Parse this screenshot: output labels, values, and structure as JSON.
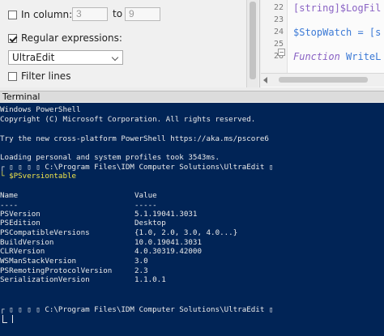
{
  "find_options": {
    "in_column_label": "In column:",
    "column_from": "3",
    "to_label": "to",
    "column_to": "9",
    "regex_label": "Regular expressions:",
    "regex_engine": "UltraEdit",
    "filter_lines_label": "Filter lines"
  },
  "editor": {
    "lines": [
      {
        "num": "22",
        "text": "[string]$LogFil",
        "color": "#8a63c4"
      },
      {
        "num": "23",
        "text": "",
        "color": "#222222"
      },
      {
        "num": "24",
        "text": "$StopWatch = [s",
        "color": "#3c7ad6"
      },
      {
        "num": "25",
        "text": "",
        "color": "#222222"
      },
      {
        "num": "26",
        "text_kw": "Function",
        "text_rest": " WriteL",
        "color": "#3c7ad6"
      }
    ]
  },
  "terminal": {
    "title": "Terminal",
    "lines": [
      "Windows PowerShell",
      "Copyright (C) Microsoft Corporation. All rights reserved.",
      "",
      "Try the new cross-platform PowerShell https://aka.ms/pscore6",
      "",
      "Loading personal and system profiles took 3543ms.",
      "┌ ▯ ▯ ▯ ▯ C:\\Program Files\\IDM Computer Solutions\\UltraEdit ▯"
    ],
    "command": "└ $PSversiontable",
    "table_header": {
      "name": "Name",
      "value": "Value"
    },
    "table_rule": {
      "name": "----",
      "value": "-----"
    },
    "rows": [
      {
        "name": "PSVersion",
        "value": "5.1.19041.3031"
      },
      {
        "name": "PSEdition",
        "value": "Desktop"
      },
      {
        "name": "PSCompatibleVersions",
        "value": "{1.0, 2.0, 3.0, 4.0...}"
      },
      {
        "name": "BuildVersion",
        "value": "10.0.19041.3031"
      },
      {
        "name": "CLRVersion",
        "value": "4.0.30319.42000"
      },
      {
        "name": "WSManStackVersion",
        "value": "3.0"
      },
      {
        "name": "PSRemotingProtocolVersion",
        "value": "2.3"
      },
      {
        "name": "SerializationVersion",
        "value": "1.1.0.1"
      }
    ],
    "prompt2": "┌ ▯ ▯ ▯ ▯ C:\\Program Files\\IDM Computer Solutions\\UltraEdit ▯"
  }
}
